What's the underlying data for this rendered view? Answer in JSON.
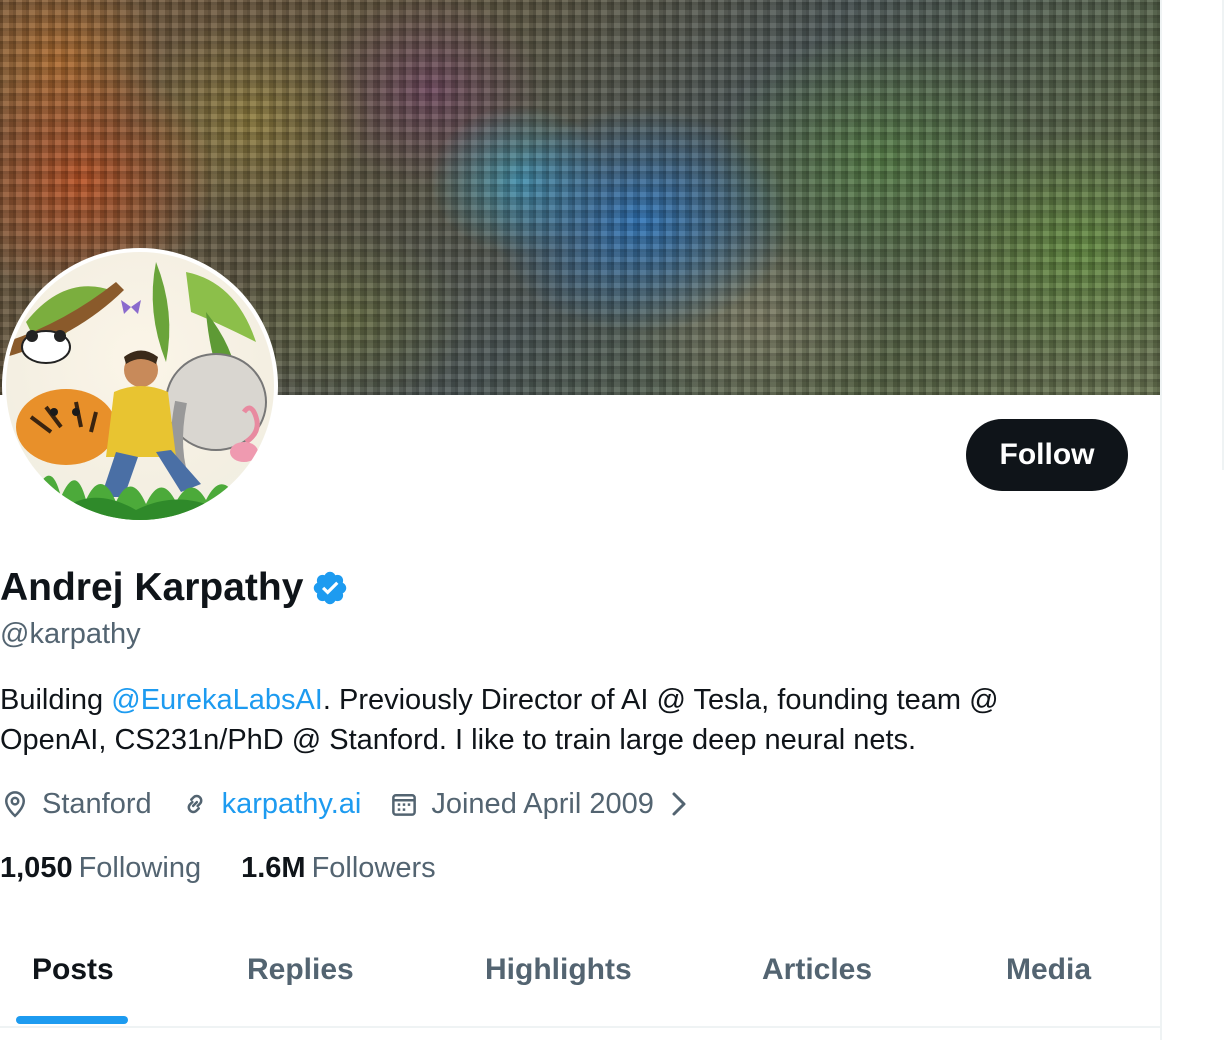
{
  "profile": {
    "display_name": "Andrej Karpathy",
    "handle": "@karpathy",
    "verified": true,
    "bio_prefix": "Building ",
    "bio_mention": "@EurekaLabsAI",
    "bio_suffix": ". Previously Director of AI @ Tesla, founding team @ OpenAI, CS231n/PhD @ Stanford. I like to train large deep neural nets.",
    "location": "Stanford",
    "website": "karpathy.ai",
    "joined": "Joined April 2009",
    "following_count": "1,050",
    "following_label": "Following",
    "followers_count": "1.6M",
    "followers_label": "Followers"
  },
  "actions": {
    "follow_label": "Follow"
  },
  "tabs": [
    {
      "label": "Posts",
      "active": true
    },
    {
      "label": "Replies",
      "active": false
    },
    {
      "label": "Highlights",
      "active": false
    },
    {
      "label": "Articles",
      "active": false
    },
    {
      "label": "Media",
      "active": false
    }
  ],
  "icons": {
    "verified": "verified-badge-icon",
    "location": "location-pin-icon",
    "website": "link-icon",
    "joined": "calendar-icon",
    "joined_more": "chevron-right-icon"
  },
  "colors": {
    "accent": "#1d9bf0",
    "text_primary": "#0f1419",
    "text_secondary": "#536471",
    "follow_button_bg": "#0f1419"
  }
}
